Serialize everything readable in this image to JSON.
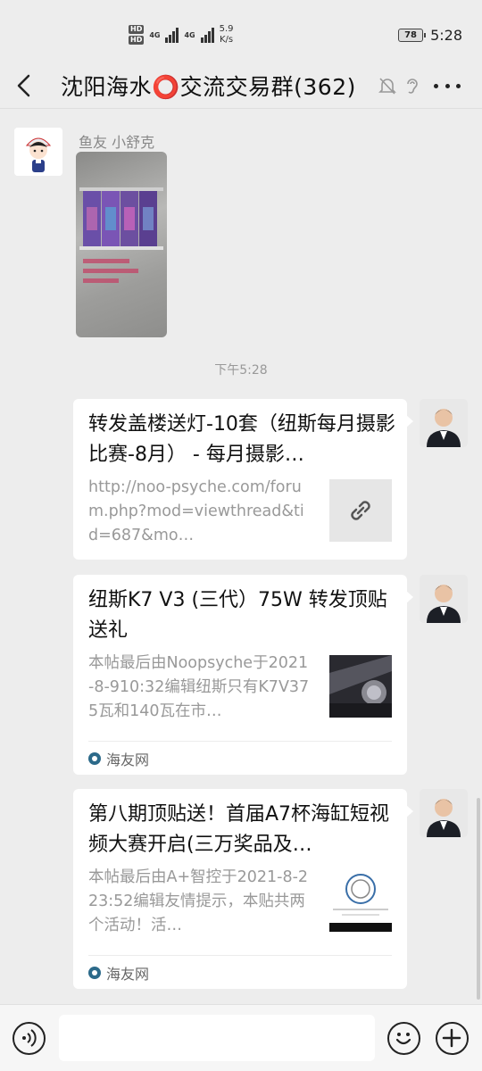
{
  "status_bar": {
    "network_left": "HD",
    "network_right": "HD",
    "gen1": "4G",
    "gen2": "4G",
    "speed_value": "5.9",
    "speed_unit": "K/s",
    "battery": "78",
    "time": "5:28"
  },
  "header": {
    "title": "沈阳海水⭕交流交易群(362)"
  },
  "messages": {
    "first_sender": "鱼友 小舒克",
    "timestamp": "下午5:28",
    "cards": [
      {
        "title": "转发盖楼送灯-10套（纽斯每月摄影比赛-8月） - 每月摄影…",
        "desc": "http://noo-psyche.com/forum.php?mod=viewthread&tid=687&mo…",
        "source": ""
      },
      {
        "title": "纽斯K7 V3 (三代）75W 转发顶贴送礼",
        "desc": "本帖最后由Noopsyche于2021-8-910:32编辑纽斯只有K7V375瓦和140瓦在市…",
        "source": "海友网"
      },
      {
        "title": "第八期顶贴送！首届A7杯海缸短视频大赛开启(三万奖品及…",
        "desc": "本帖最后由A+智控于2021-8-223:52编辑友情提示，本贴共两个活动！活…",
        "source": "海友网"
      }
    ]
  },
  "icons": {
    "back": "chevron-left-icon",
    "mute": "bell-off-icon",
    "ear": "ear-icon",
    "more": "more-horizontal-icon",
    "link": "link-icon",
    "voice": "voice-icon",
    "emoji": "smiley-icon",
    "plus": "plus-icon"
  }
}
